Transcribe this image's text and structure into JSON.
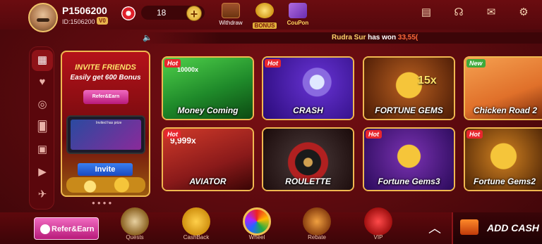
{
  "header": {
    "username": "P1506200",
    "user_id": "ID:1506200",
    "vip_level": "V0",
    "balance": "18",
    "actions": [
      {
        "label": "Withdraw"
      },
      {
        "label": "BONUS"
      },
      {
        "label": "CouPon"
      }
    ]
  },
  "ticker": {
    "name": "Rudra Sur",
    "text": " has won ",
    "amount": "33,55("
  },
  "banner": {
    "title": "INVITE FRIENDS",
    "subtitle": "Easily get 600 Bonus",
    "refer_label": "Refer&Earn",
    "phone_text": "Invited has prize",
    "invite_label": "Invite"
  },
  "games": [
    {
      "title": "Money Coming",
      "badge": "Hot",
      "bg": "#1f8a2a"
    },
    {
      "title": "CRASH",
      "badge": "Hot",
      "bg": "#5a2ac0"
    },
    {
      "title": "FORTUNE GEMS",
      "badge": "",
      "bg": "#a0501a"
    },
    {
      "title": "Chicken Road 2",
      "badge": "New",
      "bg": "#e0702a"
    },
    {
      "title": "AVIATOR",
      "badge": "Hot",
      "bg": "#8a1a1a"
    },
    {
      "title": "ROULETTE",
      "badge": "",
      "bg": "#3a2a2a"
    },
    {
      "title": "Fortune Gems3",
      "badge": "Hot",
      "bg": "#6a2aa0"
    },
    {
      "title": "Fortune Gems2",
      "badge": "Hot",
      "bg": "#b06a1a"
    }
  ],
  "card_extras": {
    "money_coming_top": "10000x",
    "aviator_top": "9,999x",
    "fortune_gems_mult": "15x"
  },
  "bottom": {
    "refer_label": "Refer&Earn",
    "nav": [
      {
        "label": "Quests"
      },
      {
        "label": "CashBack"
      },
      {
        "label": "Wheel"
      },
      {
        "label": "Rebate"
      },
      {
        "label": "VIP"
      }
    ],
    "addcash_label": "ADD CASH"
  }
}
